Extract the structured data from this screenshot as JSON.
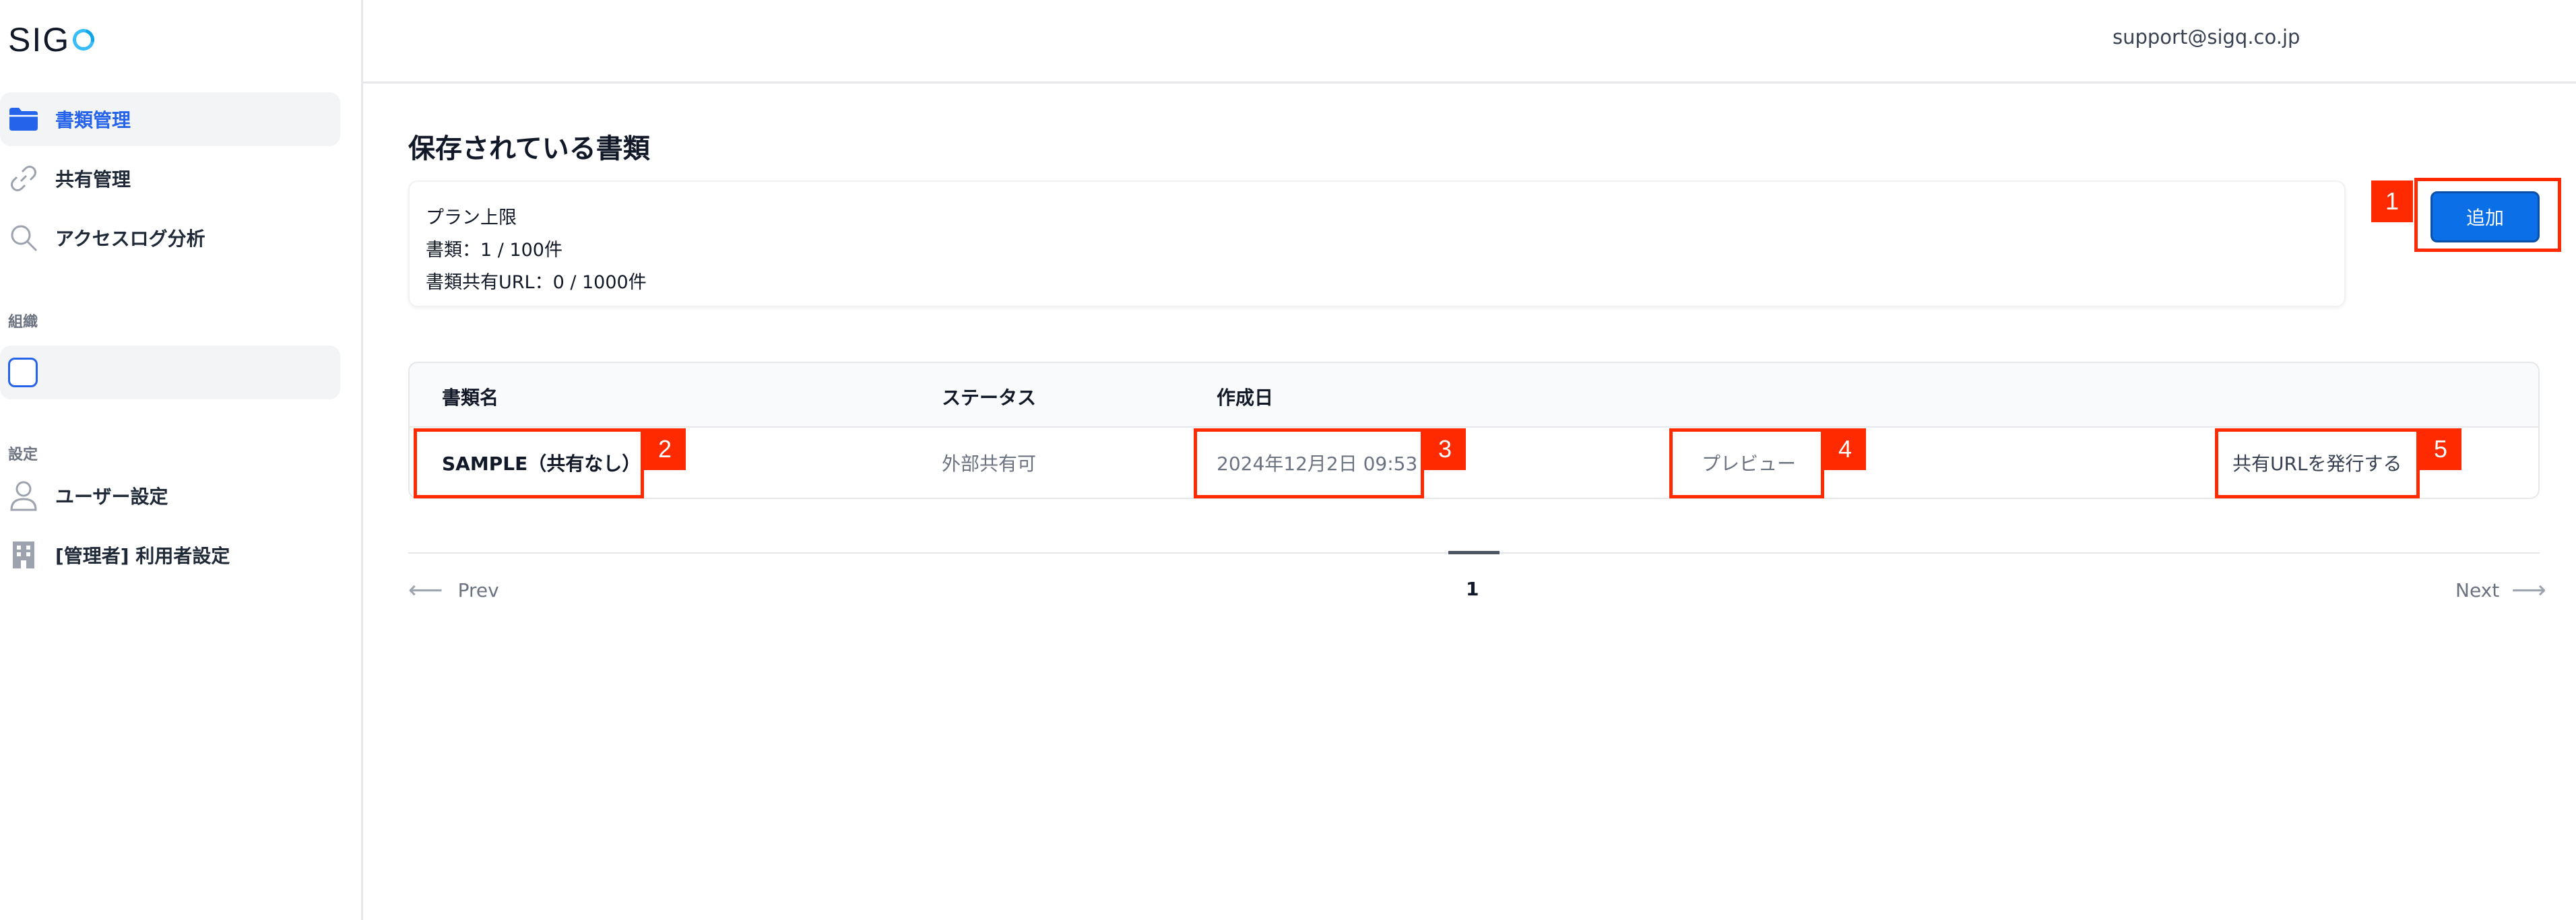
{
  "app": {
    "logo_text": "SIG"
  },
  "header": {
    "email": "support@sigq.co.jp"
  },
  "sidebar": {
    "items": [
      {
        "label": "書類管理",
        "icon": "folder-icon",
        "active": true
      },
      {
        "label": "共有管理",
        "icon": "link-icon"
      },
      {
        "label": "アクセスログ分析",
        "icon": "search-icon"
      }
    ],
    "org_section_label": "組織",
    "settings_section_label": "設定",
    "settings_items": [
      {
        "label": "ユーザー設定",
        "icon": "user-icon"
      },
      {
        "label": "[管理者] 利用者設定",
        "icon": "building-icon"
      }
    ]
  },
  "main": {
    "title": "保存されている書類",
    "plan": {
      "heading": "プラン上限",
      "documents": "書類：1 / 100件",
      "share_urls": "書類共有URL：0 / 1000件"
    },
    "add_button": "追加",
    "table": {
      "headers": [
        "書類名",
        "ステータス",
        "作成日"
      ],
      "rows": [
        {
          "name": "SAMPLE（共有なし）",
          "status": "外部共有可",
          "created": "2024年12月2日 09:53",
          "preview": "プレビュー",
          "share": "共有URLを発行する"
        }
      ]
    },
    "pagination": {
      "prev": "Prev",
      "next": "Next",
      "current": "1"
    }
  },
  "annotations": [
    "1",
    "2",
    "3",
    "4",
    "5"
  ],
  "colors": {
    "accent": "#0b6fe8",
    "annotation": "#ff2a00",
    "active_nav": "#2563eb"
  }
}
